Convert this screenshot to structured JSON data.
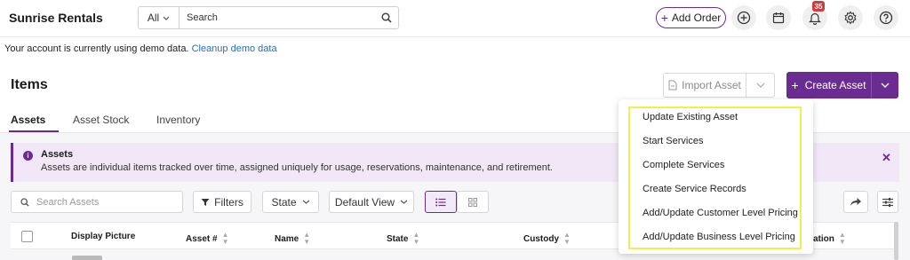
{
  "app": {
    "title": "Sunrise Rentals"
  },
  "search": {
    "scope": "All",
    "placeholder": "Search"
  },
  "header_actions": {
    "add_order_label": "Add Order",
    "notification_count": "35"
  },
  "demo_notice": {
    "text": "Your account is currently using demo data.",
    "link": "Cleanup demo data"
  },
  "page": {
    "title": "Items",
    "import_label": "Import Asset",
    "create_label": "Create Asset"
  },
  "tabs": [
    {
      "label": "Assets",
      "active": true
    },
    {
      "label": "Asset Stock",
      "active": false
    },
    {
      "label": "Inventory",
      "active": false
    }
  ],
  "info_banner": {
    "title": "Assets",
    "description": "Assets are individual items tracked over time, assigned uniquely for usage, reservations, maintenance, and retirement."
  },
  "toolbar": {
    "search_placeholder": "Search Assets",
    "filters_label": "Filters",
    "state_label": "State",
    "view_label": "Default View"
  },
  "table": {
    "columns": [
      "Display Picture",
      "Asset #",
      "Name",
      "State",
      "Custody",
      "ation"
    ]
  },
  "create_menu": {
    "items": [
      "Update Existing Asset",
      "Start Services",
      "Complete Services",
      "Create Service Records",
      "Add/Update Customer Level Pricing",
      "Add/Update Business Level Pricing"
    ]
  },
  "colors": {
    "brand": "#6a2c91",
    "highlight": "#f3ee4a",
    "badge": "#d33a3a",
    "link": "#2a6fb8"
  }
}
